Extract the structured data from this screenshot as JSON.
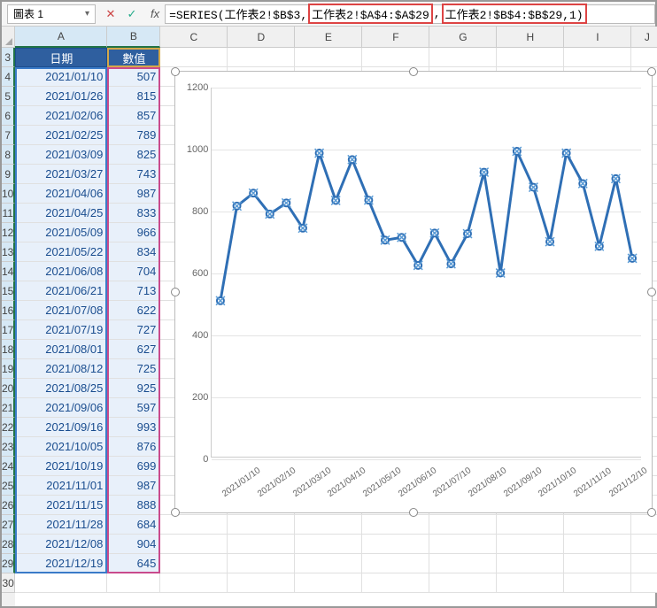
{
  "nameBox": "圖表 1",
  "formula": {
    "pre": "=SERIES(工作表2!$B$3,",
    "arg_x": "工作表2!$A$4:$A$29",
    "mid": ",",
    "arg_y": "工作表2!$B$4:$B$29,1)"
  },
  "columns": [
    "A",
    "B",
    "C",
    "D",
    "E",
    "F",
    "G",
    "H",
    "I",
    "J"
  ],
  "headerRowNum": "3",
  "dataHeaders": {
    "A": "日期",
    "B": "數值"
  },
  "rows": [
    {
      "n": "4",
      "date": "2021/01/10",
      "val": "507"
    },
    {
      "n": "5",
      "date": "2021/01/26",
      "val": "815"
    },
    {
      "n": "6",
      "date": "2021/02/06",
      "val": "857"
    },
    {
      "n": "7",
      "date": "2021/02/25",
      "val": "789"
    },
    {
      "n": "8",
      "date": "2021/03/09",
      "val": "825"
    },
    {
      "n": "9",
      "date": "2021/03/27",
      "val": "743"
    },
    {
      "n": "10",
      "date": "2021/04/06",
      "val": "987"
    },
    {
      "n": "11",
      "date": "2021/04/25",
      "val": "833"
    },
    {
      "n": "12",
      "date": "2021/05/09",
      "val": "966"
    },
    {
      "n": "13",
      "date": "2021/05/22",
      "val": "834"
    },
    {
      "n": "14",
      "date": "2021/06/08",
      "val": "704"
    },
    {
      "n": "15",
      "date": "2021/06/21",
      "val": "713"
    },
    {
      "n": "16",
      "date": "2021/07/08",
      "val": "622"
    },
    {
      "n": "17",
      "date": "2021/07/19",
      "val": "727"
    },
    {
      "n": "18",
      "date": "2021/08/01",
      "val": "627"
    },
    {
      "n": "19",
      "date": "2021/08/12",
      "val": "725"
    },
    {
      "n": "20",
      "date": "2021/08/25",
      "val": "925"
    },
    {
      "n": "21",
      "date": "2021/09/06",
      "val": "597"
    },
    {
      "n": "22",
      "date": "2021/09/16",
      "val": "993"
    },
    {
      "n": "23",
      "date": "2021/10/05",
      "val": "876"
    },
    {
      "n": "24",
      "date": "2021/10/19",
      "val": "699"
    },
    {
      "n": "25",
      "date": "2021/11/01",
      "val": "987"
    },
    {
      "n": "26",
      "date": "2021/11/15",
      "val": "888"
    },
    {
      "n": "27",
      "date": "2021/11/28",
      "val": "684"
    },
    {
      "n": "28",
      "date": "2021/12/08",
      "val": "904"
    },
    {
      "n": "29",
      "date": "2021/12/19",
      "val": "645"
    }
  ],
  "emptyRowNum": "30",
  "chart_data": {
    "type": "line",
    "title": "",
    "xlabel": "",
    "ylabel": "",
    "ylim": [
      0,
      1200
    ],
    "yticks": [
      0,
      200,
      400,
      600,
      800,
      1000,
      1200
    ],
    "xticks": [
      "2021/01/10",
      "2021/02/10",
      "2021/03/10",
      "2021/04/10",
      "2021/05/10",
      "2021/06/10",
      "2021/07/10",
      "2021/08/10",
      "2021/09/10",
      "2021/10/10",
      "2021/11/10",
      "2021/12/10"
    ],
    "categories": [
      "2021/01/10",
      "2021/01/26",
      "2021/02/06",
      "2021/02/25",
      "2021/03/09",
      "2021/03/27",
      "2021/04/06",
      "2021/04/25",
      "2021/05/09",
      "2021/05/22",
      "2021/06/08",
      "2021/06/21",
      "2021/07/08",
      "2021/07/19",
      "2021/08/01",
      "2021/08/12",
      "2021/08/25",
      "2021/09/06",
      "2021/09/16",
      "2021/10/05",
      "2021/10/19",
      "2021/11/01",
      "2021/11/15",
      "2021/11/28",
      "2021/12/08",
      "2021/12/19"
    ],
    "values": [
      507,
      815,
      857,
      789,
      825,
      743,
      987,
      833,
      966,
      834,
      704,
      713,
      622,
      727,
      627,
      725,
      925,
      597,
      993,
      876,
      699,
      987,
      888,
      684,
      904,
      645
    ],
    "series_color": "#2f6fb5"
  }
}
